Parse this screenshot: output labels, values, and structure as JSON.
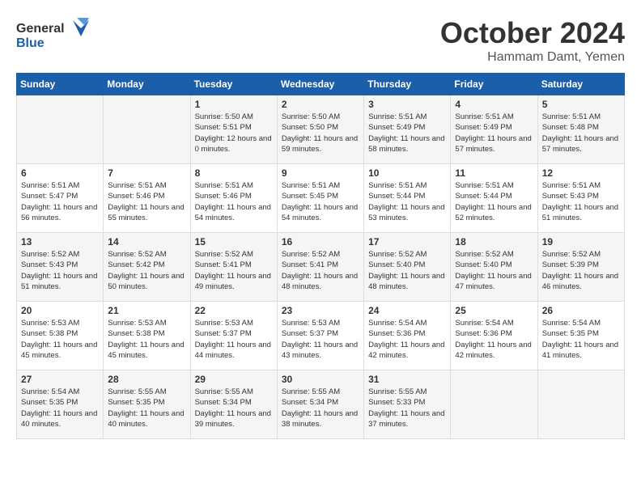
{
  "header": {
    "logo_general": "General",
    "logo_blue": "Blue",
    "month": "October 2024",
    "location": "Hammam Damt, Yemen"
  },
  "days_of_week": [
    "Sunday",
    "Monday",
    "Tuesday",
    "Wednesday",
    "Thursday",
    "Friday",
    "Saturday"
  ],
  "weeks": [
    [
      {
        "day": "",
        "info": ""
      },
      {
        "day": "",
        "info": ""
      },
      {
        "day": "1",
        "sunrise": "Sunrise: 5:50 AM",
        "sunset": "Sunset: 5:51 PM",
        "daylight": "Daylight: 12 hours and 0 minutes."
      },
      {
        "day": "2",
        "sunrise": "Sunrise: 5:50 AM",
        "sunset": "Sunset: 5:50 PM",
        "daylight": "Daylight: 11 hours and 59 minutes."
      },
      {
        "day": "3",
        "sunrise": "Sunrise: 5:51 AM",
        "sunset": "Sunset: 5:49 PM",
        "daylight": "Daylight: 11 hours and 58 minutes."
      },
      {
        "day": "4",
        "sunrise": "Sunrise: 5:51 AM",
        "sunset": "Sunset: 5:49 PM",
        "daylight": "Daylight: 11 hours and 57 minutes."
      },
      {
        "day": "5",
        "sunrise": "Sunrise: 5:51 AM",
        "sunset": "Sunset: 5:48 PM",
        "daylight": "Daylight: 11 hours and 57 minutes."
      }
    ],
    [
      {
        "day": "6",
        "sunrise": "Sunrise: 5:51 AM",
        "sunset": "Sunset: 5:47 PM",
        "daylight": "Daylight: 11 hours and 56 minutes."
      },
      {
        "day": "7",
        "sunrise": "Sunrise: 5:51 AM",
        "sunset": "Sunset: 5:46 PM",
        "daylight": "Daylight: 11 hours and 55 minutes."
      },
      {
        "day": "8",
        "sunrise": "Sunrise: 5:51 AM",
        "sunset": "Sunset: 5:46 PM",
        "daylight": "Daylight: 11 hours and 54 minutes."
      },
      {
        "day": "9",
        "sunrise": "Sunrise: 5:51 AM",
        "sunset": "Sunset: 5:45 PM",
        "daylight": "Daylight: 11 hours and 54 minutes."
      },
      {
        "day": "10",
        "sunrise": "Sunrise: 5:51 AM",
        "sunset": "Sunset: 5:44 PM",
        "daylight": "Daylight: 11 hours and 53 minutes."
      },
      {
        "day": "11",
        "sunrise": "Sunrise: 5:51 AM",
        "sunset": "Sunset: 5:44 PM",
        "daylight": "Daylight: 11 hours and 52 minutes."
      },
      {
        "day": "12",
        "sunrise": "Sunrise: 5:51 AM",
        "sunset": "Sunset: 5:43 PM",
        "daylight": "Daylight: 11 hours and 51 minutes."
      }
    ],
    [
      {
        "day": "13",
        "sunrise": "Sunrise: 5:52 AM",
        "sunset": "Sunset: 5:43 PM",
        "daylight": "Daylight: 11 hours and 51 minutes."
      },
      {
        "day": "14",
        "sunrise": "Sunrise: 5:52 AM",
        "sunset": "Sunset: 5:42 PM",
        "daylight": "Daylight: 11 hours and 50 minutes."
      },
      {
        "day": "15",
        "sunrise": "Sunrise: 5:52 AM",
        "sunset": "Sunset: 5:41 PM",
        "daylight": "Daylight: 11 hours and 49 minutes."
      },
      {
        "day": "16",
        "sunrise": "Sunrise: 5:52 AM",
        "sunset": "Sunset: 5:41 PM",
        "daylight": "Daylight: 11 hours and 48 minutes."
      },
      {
        "day": "17",
        "sunrise": "Sunrise: 5:52 AM",
        "sunset": "Sunset: 5:40 PM",
        "daylight": "Daylight: 11 hours and 48 minutes."
      },
      {
        "day": "18",
        "sunrise": "Sunrise: 5:52 AM",
        "sunset": "Sunset: 5:40 PM",
        "daylight": "Daylight: 11 hours and 47 minutes."
      },
      {
        "day": "19",
        "sunrise": "Sunrise: 5:52 AM",
        "sunset": "Sunset: 5:39 PM",
        "daylight": "Daylight: 11 hours and 46 minutes."
      }
    ],
    [
      {
        "day": "20",
        "sunrise": "Sunrise: 5:53 AM",
        "sunset": "Sunset: 5:38 PM",
        "daylight": "Daylight: 11 hours and 45 minutes."
      },
      {
        "day": "21",
        "sunrise": "Sunrise: 5:53 AM",
        "sunset": "Sunset: 5:38 PM",
        "daylight": "Daylight: 11 hours and 45 minutes."
      },
      {
        "day": "22",
        "sunrise": "Sunrise: 5:53 AM",
        "sunset": "Sunset: 5:37 PM",
        "daylight": "Daylight: 11 hours and 44 minutes."
      },
      {
        "day": "23",
        "sunrise": "Sunrise: 5:53 AM",
        "sunset": "Sunset: 5:37 PM",
        "daylight": "Daylight: 11 hours and 43 minutes."
      },
      {
        "day": "24",
        "sunrise": "Sunrise: 5:54 AM",
        "sunset": "Sunset: 5:36 PM",
        "daylight": "Daylight: 11 hours and 42 minutes."
      },
      {
        "day": "25",
        "sunrise": "Sunrise: 5:54 AM",
        "sunset": "Sunset: 5:36 PM",
        "daylight": "Daylight: 11 hours and 42 minutes."
      },
      {
        "day": "26",
        "sunrise": "Sunrise: 5:54 AM",
        "sunset": "Sunset: 5:35 PM",
        "daylight": "Daylight: 11 hours and 41 minutes."
      }
    ],
    [
      {
        "day": "27",
        "sunrise": "Sunrise: 5:54 AM",
        "sunset": "Sunset: 5:35 PM",
        "daylight": "Daylight: 11 hours and 40 minutes."
      },
      {
        "day": "28",
        "sunrise": "Sunrise: 5:55 AM",
        "sunset": "Sunset: 5:35 PM",
        "daylight": "Daylight: 11 hours and 40 minutes."
      },
      {
        "day": "29",
        "sunrise": "Sunrise: 5:55 AM",
        "sunset": "Sunset: 5:34 PM",
        "daylight": "Daylight: 11 hours and 39 minutes."
      },
      {
        "day": "30",
        "sunrise": "Sunrise: 5:55 AM",
        "sunset": "Sunset: 5:34 PM",
        "daylight": "Daylight: 11 hours and 38 minutes."
      },
      {
        "day": "31",
        "sunrise": "Sunrise: 5:55 AM",
        "sunset": "Sunset: 5:33 PM",
        "daylight": "Daylight: 11 hours and 37 minutes."
      },
      {
        "day": "",
        "info": ""
      },
      {
        "day": "",
        "info": ""
      }
    ]
  ]
}
